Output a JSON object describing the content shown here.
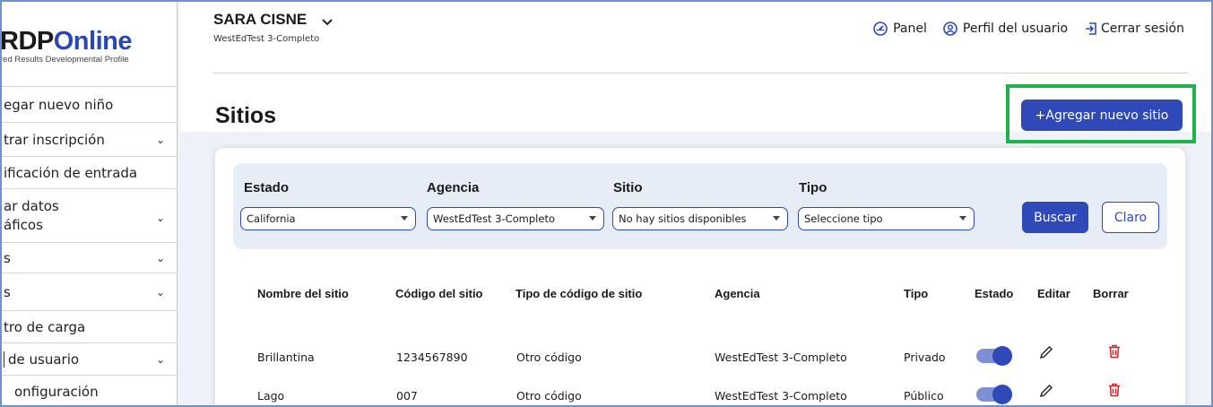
{
  "logo": {
    "main_dark": "RDP",
    "main_blue": "Online",
    "subtitle": "red Results Developmental Profile"
  },
  "sidebar": {
    "items": [
      {
        "label": "egar nuevo niño",
        "has_chevron": false
      },
      {
        "label": "trar inscripción",
        "has_chevron": true
      },
      {
        "label": "ificación de entrada",
        "has_chevron": false
      },
      {
        "label": "ar datos",
        "label2": "áficos",
        "has_chevron": true
      },
      {
        "label": "s",
        "has_chevron": true
      },
      {
        "label": "s",
        "has_chevron": true
      },
      {
        "label": "tro de carga",
        "has_chevron": false
      },
      {
        "label": "de usuario",
        "has_chevron": true
      },
      {
        "label": "onfiguración",
        "has_chevron": false
      }
    ],
    "chevron": "⌄"
  },
  "header": {
    "user_name": "SARA CISNE",
    "agency": "WestEdTest 3-Completo",
    "nav": {
      "panel": "Panel",
      "profile": "Perfil del usuario",
      "logout": "Cerrar sesión"
    }
  },
  "page": {
    "title": "Sitios",
    "add_button": "+Agregar nuevo sitio"
  },
  "filters": {
    "estado": {
      "label": "Estado",
      "value": "California"
    },
    "agencia": {
      "label": "Agencia",
      "value": "WestEdTest 3-Completo"
    },
    "sitio": {
      "label": "Sitio",
      "value": "No hay sitios disponibles"
    },
    "tipo": {
      "label": "Tipo",
      "value": "Seleccione tipo"
    },
    "search_button": "Buscar",
    "clear_button": "Claro"
  },
  "table": {
    "headers": [
      "Nombre del sitio",
      "Código del sitio",
      "Tipo de código de sitio",
      "Agencia",
      "Tipo",
      "Estado",
      "Editar",
      "Borrar"
    ],
    "rows": [
      {
        "name": "Brillantina",
        "code": "1234567890",
        "code_type": "Otro código",
        "agency": "WestEdTest 3-Completo",
        "type": "Privado",
        "active": true
      },
      {
        "name": "Lago",
        "code": "007",
        "code_type": "Otro código",
        "agency": "WestEdTest 3-Completo",
        "type": "Público",
        "active": true
      }
    ]
  },
  "colors": {
    "primary": "#2f49b8",
    "highlight": "#20b04c",
    "delete": "#d0202a"
  }
}
